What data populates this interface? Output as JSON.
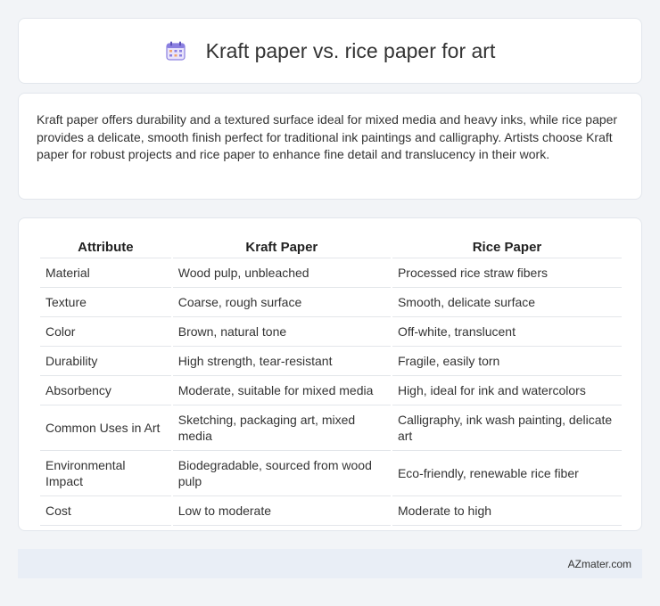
{
  "header": {
    "title": "Kraft paper vs. rice paper for art",
    "icon": "calendar-icon",
    "icon_color": "#7b6fd6"
  },
  "summary": {
    "text": "Kraft paper offers durability and a textured surface ideal for mixed media and heavy inks, while rice paper provides a delicate, smooth finish perfect for traditional ink paintings and calligraphy. Artists choose Kraft paper for robust projects and rice paper to enhance fine detail and translucency in their work."
  },
  "table": {
    "headers": [
      "Attribute",
      "Kraft Paper",
      "Rice Paper"
    ],
    "rows": [
      [
        "Material",
        "Wood pulp, unbleached",
        "Processed rice straw fibers"
      ],
      [
        "Texture",
        "Coarse, rough surface",
        "Smooth, delicate surface"
      ],
      [
        "Color",
        "Brown, natural tone",
        "Off-white, translucent"
      ],
      [
        "Durability",
        "High strength, tear-resistant",
        "Fragile, easily torn"
      ],
      [
        "Absorbency",
        "Moderate, suitable for mixed media",
        "High, ideal for ink and watercolors"
      ],
      [
        "Common Uses in Art",
        "Sketching, packaging art, mixed media",
        "Calligraphy, ink wash painting, delicate art"
      ],
      [
        "Environmental Impact",
        "Biodegradable, sourced from wood pulp",
        "Eco-friendly, renewable rice fiber"
      ],
      [
        "Cost",
        "Low to moderate",
        "Moderate to high"
      ]
    ]
  },
  "footer": {
    "brand": "AZmater.com"
  }
}
